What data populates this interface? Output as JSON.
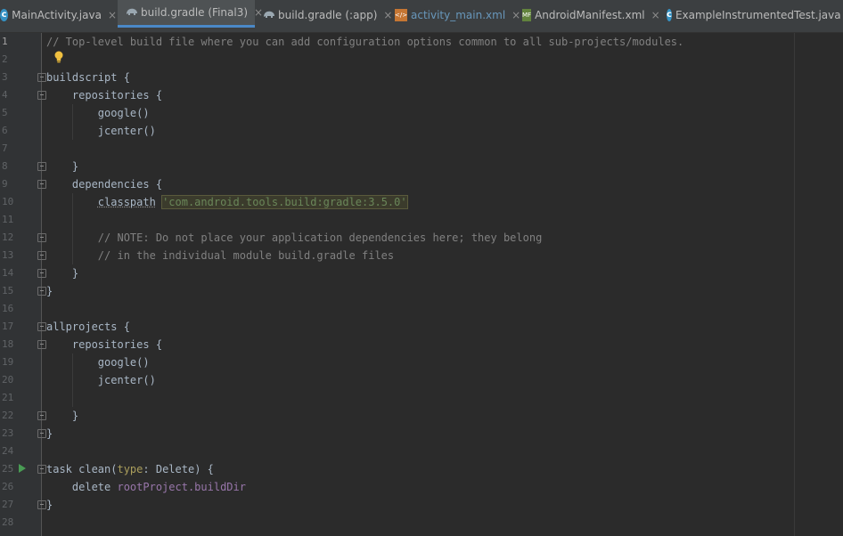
{
  "tabs": [
    {
      "label": "MainActivity.java",
      "icon": "java-class-icon"
    },
    {
      "label": "build.gradle (Final3)",
      "icon": "gradle-icon",
      "active": true
    },
    {
      "label": "build.gradle (:app)",
      "icon": "gradle-icon"
    },
    {
      "label": "activity_main.xml",
      "icon": "xml-file-icon"
    },
    {
      "label": "AndroidManifest.xml",
      "icon": "manifest-file-icon"
    },
    {
      "label": "ExampleInstrumentedTest.java",
      "icon": "java-test-class-icon"
    }
  ],
  "tab_close_symbol": "×",
  "line_numbers": [
    "1",
    "2",
    "3",
    "4",
    "5",
    "6",
    "7",
    "8",
    "9",
    "10",
    "11",
    "12",
    "13",
    "14",
    "15",
    "16",
    "17",
    "18",
    "19",
    "20",
    "21",
    "22",
    "23",
    "24",
    "25",
    "26",
    "27",
    "28"
  ],
  "code": {
    "l1": "// Top-level build file where you can add configuration options common to all sub-projects/modules.",
    "l3": "buildscript {",
    "l4": "    repositories {",
    "l5": "        google()",
    "l6": "        jcenter()",
    "l8": "    }",
    "l9": "    dependencies {",
    "l10_kw": "classpath",
    "l10_str": "'com.android.tools.build:gradle:3.5.0'",
    "l12": "        // NOTE: Do not place your application dependencies here; they belong",
    "l13": "        // in the individual module build.gradle files",
    "l14": "    }",
    "l15": "}",
    "l17": "allprojects {",
    "l18": "    repositories {",
    "l19": "        google()",
    "l20": "        jcenter()",
    "l22": "    }",
    "l23": "}",
    "l25_a": "task clean(",
    "l25_named": "type",
    "l25_b": ": Delete) {",
    "l26_a": "    delete ",
    "l26_prop": "rootProject.buildDir",
    "l27": "}"
  },
  "colors": {
    "editor_bg": "#2b2b2b",
    "gutter_bg": "#313335",
    "active_tab_underline": "#4a88c7",
    "string": "#6a8759",
    "comment": "#808080"
  }
}
